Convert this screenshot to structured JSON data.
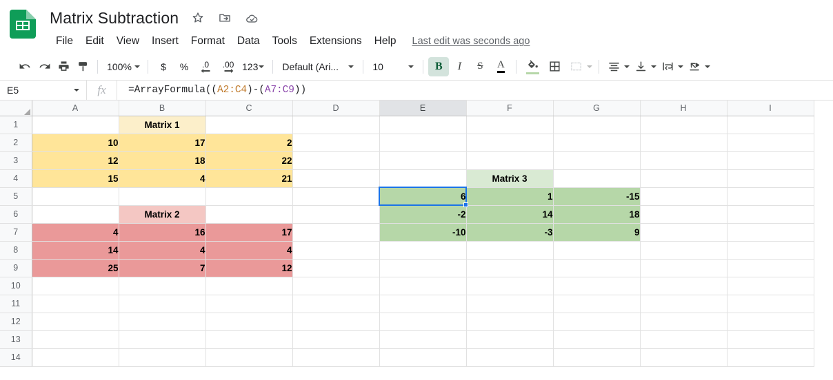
{
  "app": {
    "logo_icon": "google-sheets-logo-icon",
    "doc_title": "Matrix Subtraction",
    "title_icons": [
      {
        "name": "star-icon",
        "label": "Star"
      },
      {
        "name": "move-to-folder-icon",
        "label": "Move"
      },
      {
        "name": "cloud-saved-icon",
        "label": "Saved to Drive"
      }
    ],
    "menus": [
      "File",
      "Edit",
      "View",
      "Insert",
      "Format",
      "Data",
      "Tools",
      "Extensions",
      "Help"
    ],
    "last_edit": "Last edit was seconds ago"
  },
  "toolbar": {
    "undo": "undo-icon",
    "redo": "redo-icon",
    "print": "print-icon",
    "paint_format": "paint-format-icon",
    "zoom_value": "100%",
    "currency": "$",
    "percent": "%",
    "decrease_decimal": ".0",
    "increase_decimal": ".00",
    "more_formats": "123",
    "font_name": "Default (Ari...",
    "font_size": "10",
    "bold": "B",
    "italic": "I",
    "strikethrough": "S",
    "text_color": "A",
    "fill_color": "fill-color-icon",
    "borders": "borders-icon",
    "merge_cells": "merge-cells-icon",
    "horizontal_align": "horizontal-align-icon",
    "vertical_align": "vertical-align-icon",
    "text_wrap": "text-wrap-icon",
    "text_rotation": "text-rotation-icon",
    "fill_color_swatch": "#b6d7a8",
    "bold_active_bg": "#d3e3dc"
  },
  "formula_bar": {
    "name_box": "E5",
    "fx_label": "fx",
    "formula_prefix": "=ArrayFormula((",
    "formula_ref1": "A2:C4",
    "formula_mid": ")-(",
    "formula_ref2": "A7:C9",
    "formula_suffix": "))",
    "ref1_color": "#c07a2b",
    "ref2_color": "#8b46ab"
  },
  "sheet": {
    "columns": [
      "A",
      "B",
      "C",
      "D",
      "E",
      "F",
      "G",
      "H",
      "I"
    ],
    "active_column": "E",
    "rows": [
      "1",
      "2",
      "3",
      "4",
      "5",
      "6",
      "7",
      "8",
      "9",
      "10",
      "11",
      "12",
      "13",
      "14"
    ],
    "selected_cell": "E5",
    "selection_color": "#1a73e8",
    "cells": {
      "B1": {
        "value": "Matrix 1",
        "fill": "f-yellow-lt",
        "align": "hdr"
      },
      "A2": {
        "value": "10",
        "fill": "f-yellow",
        "align": "num"
      },
      "B2": {
        "value": "17",
        "fill": "f-yellow",
        "align": "num"
      },
      "C2": {
        "value": "2",
        "fill": "f-yellow",
        "align": "num"
      },
      "A3": {
        "value": "12",
        "fill": "f-yellow",
        "align": "num"
      },
      "B3": {
        "value": "18",
        "fill": "f-yellow",
        "align": "num"
      },
      "C3": {
        "value": "22",
        "fill": "f-yellow",
        "align": "num"
      },
      "A4": {
        "value": "15",
        "fill": "f-yellow",
        "align": "num"
      },
      "B4": {
        "value": "4",
        "fill": "f-yellow",
        "align": "num"
      },
      "C4": {
        "value": "21",
        "fill": "f-yellow",
        "align": "num"
      },
      "B6": {
        "value": "Matrix 2",
        "fill": "f-red-lt",
        "align": "hdr"
      },
      "A7": {
        "value": "4",
        "fill": "f-red",
        "align": "num"
      },
      "B7": {
        "value": "16",
        "fill": "f-red",
        "align": "num"
      },
      "C7": {
        "value": "17",
        "fill": "f-red",
        "align": "num"
      },
      "A8": {
        "value": "14",
        "fill": "f-red",
        "align": "num"
      },
      "B8": {
        "value": "4",
        "fill": "f-red",
        "align": "num"
      },
      "C8": {
        "value": "4",
        "fill": "f-red",
        "align": "num"
      },
      "A9": {
        "value": "25",
        "fill": "f-red",
        "align": "num"
      },
      "B9": {
        "value": "7",
        "fill": "f-red",
        "align": "num"
      },
      "C9": {
        "value": "12",
        "fill": "f-red",
        "align": "num"
      },
      "F4": {
        "value": "Matrix 3",
        "fill": "f-green-lt",
        "align": "hdr"
      },
      "E5": {
        "value": "6",
        "fill": "f-green",
        "align": "num"
      },
      "F5": {
        "value": "1",
        "fill": "f-green",
        "align": "num"
      },
      "G5": {
        "value": "-15",
        "fill": "f-green",
        "align": "num"
      },
      "E6": {
        "value": "-2",
        "fill": "f-green",
        "align": "num"
      },
      "F6": {
        "value": "14",
        "fill": "f-green",
        "align": "num"
      },
      "G6": {
        "value": "18",
        "fill": "f-green",
        "align": "num"
      },
      "E7": {
        "value": "-10",
        "fill": "f-green",
        "align": "num"
      },
      "F7": {
        "value": "-3",
        "fill": "f-green",
        "align": "num"
      },
      "G7": {
        "value": "9",
        "fill": "f-green",
        "align": "num"
      }
    },
    "matrices": {
      "matrix1": {
        "label": "Matrix 1",
        "values": [
          [
            10,
            17,
            2
          ],
          [
            12,
            18,
            22
          ],
          [
            15,
            4,
            21
          ]
        ],
        "fill": "#ffe599"
      },
      "matrix2": {
        "label": "Matrix 2",
        "values": [
          [
            4,
            16,
            17
          ],
          [
            14,
            4,
            4
          ],
          [
            25,
            7,
            12
          ]
        ],
        "fill": "#ea9999"
      },
      "matrix3": {
        "label": "Matrix 3",
        "values": [
          [
            6,
            1,
            -15
          ],
          [
            -2,
            14,
            18
          ],
          [
            -10,
            -3,
            9
          ]
        ],
        "fill": "#b6d7a8"
      }
    }
  }
}
